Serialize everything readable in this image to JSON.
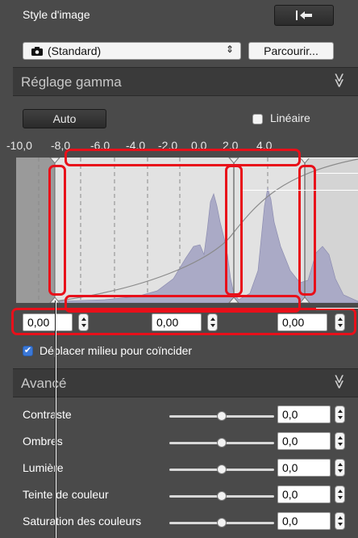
{
  "picture_style": {
    "title": "Style d'image",
    "selected": "(Standard)",
    "browse_label": "Parcourir..."
  },
  "gamma": {
    "header": "Réglage gamma",
    "auto_label": "Auto",
    "linear_label": "Linéaire",
    "linear_checked": false,
    "scale_ticks": [
      "-10,0",
      "-8,0",
      "-6,0",
      "-4,0",
      "-2,0",
      "0,0",
      "2,0",
      "4,0"
    ],
    "values": [
      "0,00",
      "0,00",
      "0,00"
    ]
  },
  "match_midpoint": {
    "label": "Déplacer milieu pour coïncider",
    "checked": true
  },
  "advanced": {
    "header": "Avancé",
    "rows": [
      {
        "label": "Contraste",
        "value": "0,0"
      },
      {
        "label": "Ombres",
        "value": "0,0"
      },
      {
        "label": "Lumière",
        "value": "0,0"
      },
      {
        "label": "Teinte de couleur",
        "value": "0,0"
      },
      {
        "label": "Saturation des couleurs",
        "value": "0,0"
      }
    ]
  },
  "colors": {
    "panel": "#4a4a4a",
    "header": "#3a3a3a",
    "histogram_fill": "#aaaac6",
    "annotation_red": "#e8101a",
    "checkbox_blue": "#3b78d8"
  }
}
